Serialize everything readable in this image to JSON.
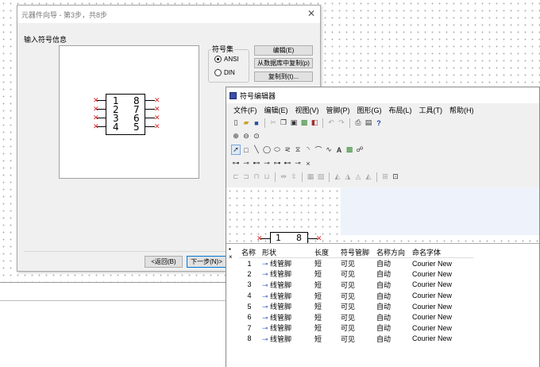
{
  "wizard": {
    "title": "元器件向导 - 第3步，共8步",
    "close": "✕",
    "section_label": "输入符号信息",
    "pins_left": [
      "1",
      "2",
      "3",
      "4"
    ],
    "pins_right": [
      "8",
      "7",
      "6",
      "5"
    ],
    "symbol_set_label": "符号集",
    "radio_ansi": "ANSI",
    "radio_din": "DIN",
    "btn_edit": "编辑(E)",
    "btn_copy_db": "从数据库中复制(p)",
    "btn_copy_to": "复制到(t)...",
    "btn_back": "<返回(B)",
    "btn_next": "下一步(N)>"
  },
  "editor": {
    "title": "符号编辑器",
    "menu": [
      "文件(F)",
      "编辑(E)",
      "视图(V)",
      "管脚(P)",
      "图形(G)",
      "布局(L)",
      "工具(T)",
      "帮助(H)"
    ],
    "canvas_pins": [
      "1",
      "8"
    ],
    "panel_close": "×",
    "table_headers": [
      "名称",
      "形状",
      "长度",
      "符号管脚",
      "名称方向",
      "命名字体"
    ],
    "rows": [
      {
        "name": "1",
        "shape": "线管脚",
        "length": "短",
        "symbol_pin": "可见",
        "direction": "自动",
        "font": "Courier New"
      },
      {
        "name": "2",
        "shape": "线管脚",
        "length": "短",
        "symbol_pin": "可见",
        "direction": "自动",
        "font": "Courier New"
      },
      {
        "name": "3",
        "shape": "线管脚",
        "length": "短",
        "symbol_pin": "可见",
        "direction": "自动",
        "font": "Courier New"
      },
      {
        "name": "4",
        "shape": "线管脚",
        "length": "短",
        "symbol_pin": "可见",
        "direction": "自动",
        "font": "Courier New"
      },
      {
        "name": "5",
        "shape": "线管脚",
        "length": "短",
        "symbol_pin": "可见",
        "direction": "自动",
        "font": "Courier New"
      },
      {
        "name": "6",
        "shape": "线管脚",
        "length": "短",
        "symbol_pin": "可见",
        "direction": "自动",
        "font": "Courier New"
      },
      {
        "name": "7",
        "shape": "线管脚",
        "length": "短",
        "symbol_pin": "可见",
        "direction": "自动",
        "font": "Courier New"
      },
      {
        "name": "8",
        "shape": "线管脚",
        "length": "短",
        "symbol_pin": "可见",
        "direction": "自动",
        "font": "Courier New"
      }
    ]
  }
}
